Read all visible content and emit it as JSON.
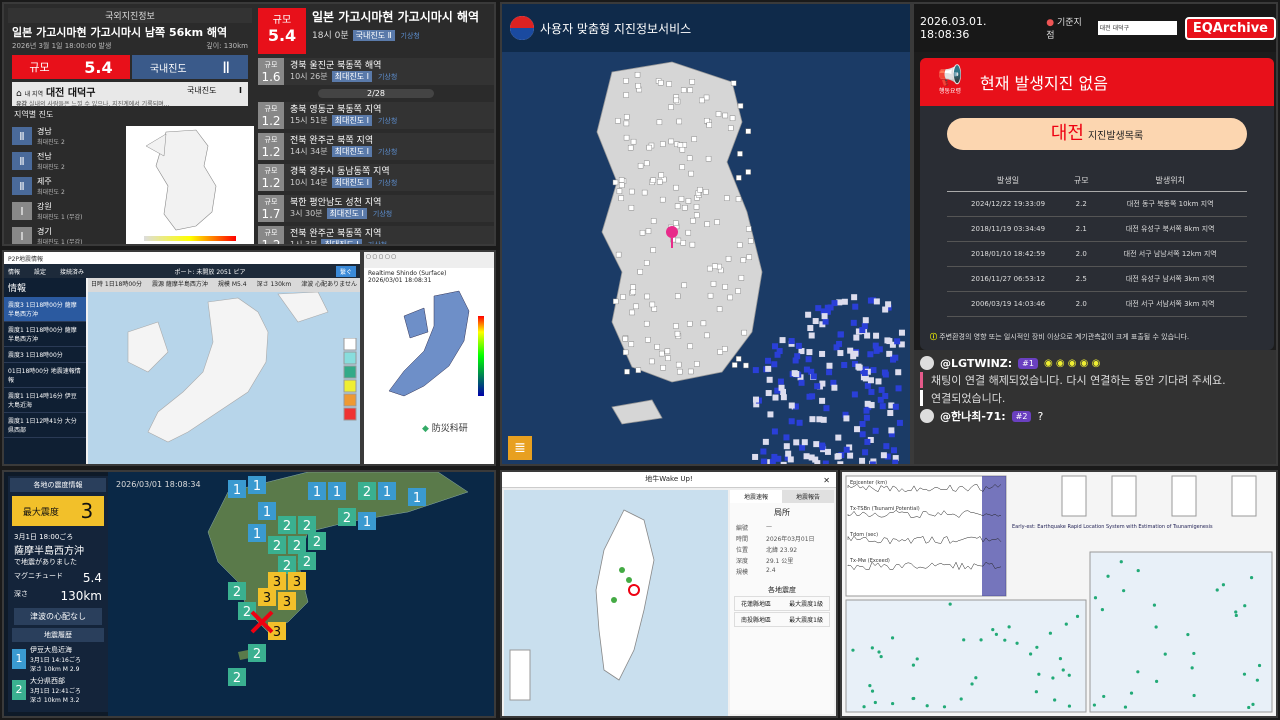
{
  "kma": {
    "header": "국외지진정보",
    "title": "일본 가고시마현 가고시마시 남쪽 56km 해역",
    "subtitle": "2026년 3월 1일 18:00:00 발생",
    "depth": "깊이: 130km",
    "mag_label": "규모",
    "mag_value": "5.4",
    "domestic_label": "국내진도",
    "domestic_value": "Ⅱ",
    "my_location_prefix": "내 지역",
    "my_location": "대전 대덕구",
    "my_location_intensity_label": "국내진도",
    "my_location_intensity": "Ⅰ",
    "notice": "실내의 사람들은 느낄 수 있으나, 지진계에서 기록되며...",
    "notice_prefix": "유감",
    "region_title": "지역별 진도",
    "regions": [
      {
        "iv": "Ⅱ",
        "name": "경남",
        "desc": "최대진도 2"
      },
      {
        "iv": "Ⅱ",
        "name": "전남",
        "desc": "최대진도 2"
      },
      {
        "iv": "Ⅱ",
        "name": "제주",
        "desc": "최대진도 2"
      },
      {
        "iv": "Ⅰ",
        "name": "강원",
        "desc": "최대진도 1 (무감)"
      },
      {
        "iv": "Ⅰ",
        "name": "경기",
        "desc": "최대진도 1 (무감)"
      }
    ],
    "latest": {
      "mag_label": "규모",
      "mag": "5.4",
      "place": "일본 가고시마현 가고시마시 해역",
      "time": "18시 0분",
      "tag": "국내진도 Ⅱ",
      "src": "기상청"
    },
    "list": [
      {
        "mag": "1.6",
        "place": "경북 울진군 북동쪽 해역",
        "time": "10시 26분",
        "tag": "최대진도 Ⅰ"
      },
      {
        "mag": "1.2",
        "place": "충북 영동군 북동쪽 지역",
        "time": "15시 51분",
        "tag": "최대진도 Ⅰ"
      },
      {
        "mag": "1.2",
        "place": "전북 완주군 북쪽 지역",
        "time": "14시 34분",
        "tag": "최대진도 Ⅰ"
      },
      {
        "mag": "1.2",
        "place": "경북 경주시 동남동쪽 지역",
        "time": "10시 14분",
        "tag": "최대진도 Ⅰ"
      },
      {
        "mag": "1.7",
        "place": "북한 평안남도 성천 지역",
        "time": "3시 30분",
        "tag": "최대진도 Ⅰ"
      },
      {
        "mag": "1.2",
        "place": "전북 완주군 북동쪽 지역",
        "time": "1시 3분",
        "tag": "최대진도 Ⅰ"
      }
    ],
    "list_mag_label": "규모",
    "date_separator": "2/28",
    "src": "기상청"
  },
  "p2p": {
    "title": "P2P地震情報",
    "menu": [
      "情報",
      "設定",
      "接続済み"
    ],
    "port": "ポート: 未開放  2051 ピア",
    "button": "繋ぐ",
    "side_header": "情報",
    "side_items": [
      "震度3 1日18時00分 薩摩半島西方沖",
      "震度1 1日18時00分 薩摩半島西方沖",
      "震度3 1日18時00分",
      "01日18時00分 地震速報情報",
      "震度1 1日14時16分 伊豆大島近海",
      "震度1 1日12時41分 大分県西部"
    ],
    "info_bar": [
      "日時 1日18時00分",
      "震源 薩摩半島西方沖",
      "規模 M5.4",
      "深さ 130km",
      "津波 心配ありません"
    ]
  },
  "nied": {
    "label": "Realtime Shindo (Surface)",
    "time": "2026/03/01 18:08:31",
    "logo": "防災科研"
  },
  "korea_map": {
    "title": "사용자 맞춤형 지진정보서비스"
  },
  "right": {
    "datetime": "2026.03.01. 18:08:36",
    "location_label": "기준지점",
    "location_select": "대전 대덕구",
    "brand": "EQArchive",
    "alert_icon_label": "행동요령",
    "alert_text": "현재 발생지진 없음",
    "city": "대전",
    "city_sub": "지진발생목록",
    "table_headers": [
      "발생일",
      "규모",
      "발생위치"
    ],
    "table_rows": [
      [
        "2024/12/22 19:33:09",
        "2.2",
        "대전 동구 북동쪽 10km 지역"
      ],
      [
        "2018/11/19 03:34:49",
        "2.1",
        "대전 유성구 북서쪽 8km 지역"
      ],
      [
        "2018/01/10 18:42:59",
        "2.0",
        "대전 서구 남남서쪽 12km 지역"
      ],
      [
        "2016/11/27 06:53:12",
        "2.5",
        "대전 유성구 남서쪽 3km 지역"
      ],
      [
        "2006/03/19 14:03:46",
        "2.0",
        "대전 서구 서남서쪽 3km 지역"
      ]
    ],
    "warning": "주변환경의 영향 또는 일시적인 장비 이상으로 계기관측값이 크게 표출될 수 있습니다.",
    "chat": {
      "user1": "@LGTWINZ:",
      "badge1": "#1",
      "msg_disconnect": "채팅이 연결 해제되었습니다. 다시 연결하는 동안 기다려 주세요.",
      "msg_connected": "연결되었습니다.",
      "user2": "@한나최-71:",
      "badge2": "#2",
      "msg2": "?"
    }
  },
  "japan": {
    "header": "各地の震度情報",
    "max_label": "最大震度",
    "max_value": "3",
    "time": "3月1日 18:00ごろ",
    "place": "薩摩半島西方沖",
    "place_sub": "で地震がありました",
    "mag_label": "マグニチュード",
    "mag_value": "5.4",
    "depth_label": "深さ",
    "depth_value": "130km",
    "tsunami": "津波の心配なし",
    "history_header": "地震履歴",
    "history": [
      {
        "iv": "1",
        "place": "伊豆大島近海",
        "time": "3月1日 14:16ごろ",
        "depth": "深さ 10km",
        "mag": "M 2.9"
      },
      {
        "iv": "2",
        "place": "大分県西部",
        "time": "3月1日 12:41ごろ",
        "depth": "深さ 10km",
        "mag": "M 3.2"
      }
    ],
    "clock": "2026/03/01 18:08:34"
  },
  "taiwan": {
    "title": "地牛Wake Up!",
    "tabs": [
      "地震速報",
      "地震報告"
    ],
    "heading": "局所",
    "fields": [
      [
        "編號",
        "—"
      ],
      [
        "時間",
        "2026年03月01日"
      ],
      [
        "位置",
        "北緯 23.92"
      ],
      [
        "深度",
        "29.1 公里"
      ],
      [
        "規模",
        "2.4"
      ]
    ],
    "section": "各地震度",
    "levels": [
      [
        "花蓮縣地區",
        "最大震度1級"
      ],
      [
        "南投縣地區",
        "最大震度1級"
      ]
    ]
  },
  "seismo": {
    "labels": [
      "Epicenter (km)",
      "Tx-TSBn (Tsunami Potential)",
      "Tdom (sec)",
      "Tx-Mw (Exceed)"
    ],
    "title": "Early-est: Earthquake Rapid Location System with Estimation of Tsunamigenesis"
  },
  "colors": {
    "red": "#e8101a",
    "brand": "#e8101a"
  }
}
